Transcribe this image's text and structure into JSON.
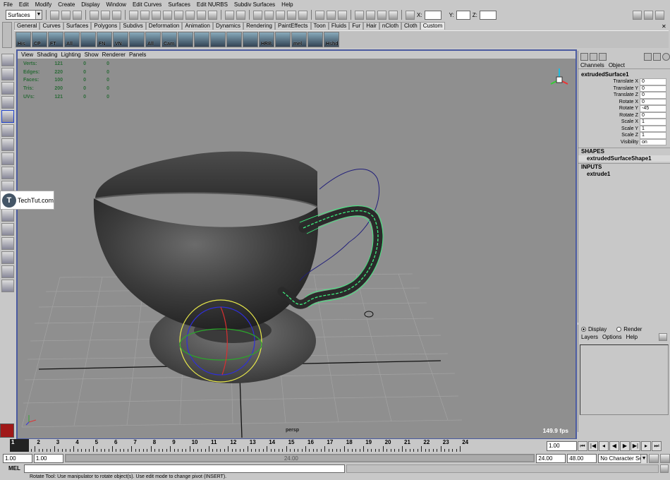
{
  "menus": [
    "File",
    "Edit",
    "Modify",
    "Create",
    "Display",
    "Window",
    "Edit Curves",
    "Surfaces",
    "Edit NURBS",
    "Subdiv Surfaces",
    "Help"
  ],
  "status": {
    "menuset": "Surfaces",
    "x_label": "X:",
    "y_label": "Y:",
    "z_label": "Z:"
  },
  "shelf_tabs": [
    "General",
    "Curves",
    "Surfaces",
    "Polygons",
    "Subdivs",
    "Deformation",
    "Animation",
    "Dynamics",
    "Rendering",
    "PaintEffects",
    "Toon",
    "Fluids",
    "Fur",
    "Hair",
    "nCloth",
    "Cloth",
    "Custom"
  ],
  "active_shelf_tab": "Custom",
  "shelf_buttons": [
    "His",
    "CP",
    "FT",
    "All",
    "",
    "FN",
    "VN",
    "",
    "All",
    "Cam",
    "",
    "",
    "",
    "",
    "",
    "HRB",
    "",
    "mel",
    "",
    "Hshd"
  ],
  "panel_menu": [
    "View",
    "Shading",
    "Lighting",
    "Show",
    "Renderer",
    "Panels"
  ],
  "hud": [
    {
      "label": "Verts:",
      "a": "121",
      "b": "0",
      "c": "0"
    },
    {
      "label": "Edges:",
      "a": "220",
      "b": "0",
      "c": "0"
    },
    {
      "label": "Faces:",
      "a": "100",
      "b": "0",
      "c": "0"
    },
    {
      "label": "Tris:",
      "a": "200",
      "b": "0",
      "c": "0"
    },
    {
      "label": "UVs:",
      "a": "121",
      "b": "0",
      "c": "0"
    }
  ],
  "viewport": {
    "camera": "persp",
    "fps": "149.9 fps"
  },
  "watermark": {
    "logo": "T",
    "text": "TechTut.com"
  },
  "channel_box": {
    "tabs": [
      "Channels",
      "Object"
    ],
    "object": "extrudedSurface1",
    "attributes": [
      {
        "name": "Translate X",
        "value": "0"
      },
      {
        "name": "Translate Y",
        "value": "0"
      },
      {
        "name": "Translate Z",
        "value": "0"
      },
      {
        "name": "Rotate X",
        "value": "0"
      },
      {
        "name": "Rotate Y",
        "value": "-45"
      },
      {
        "name": "Rotate Z",
        "value": "0"
      },
      {
        "name": "Scale X",
        "value": "1"
      },
      {
        "name": "Scale Y",
        "value": "1"
      },
      {
        "name": "Scale Z",
        "value": "1"
      },
      {
        "name": "Visibility",
        "value": "on"
      }
    ],
    "shapes_header": "SHAPES",
    "shape": "extrudedSurfaceShape1",
    "inputs_header": "INPUTS",
    "input": "extrude1"
  },
  "layer_editor": {
    "display": "Display",
    "render": "Render",
    "menu": [
      "Layers",
      "Options",
      "Help"
    ]
  },
  "timeline": {
    "ticks": [
      "1",
      "2",
      "3",
      "4",
      "5",
      "6",
      "7",
      "8",
      "9",
      "10",
      "11",
      "12",
      "13",
      "14",
      "15",
      "16",
      "17",
      "18",
      "19",
      "20",
      "21",
      "22",
      "23",
      "24"
    ],
    "current": "1"
  },
  "playback": {
    "current_field": "1.00"
  },
  "range": {
    "start": "1.00",
    "start2": "1.00",
    "end_label": "24.00",
    "end": "24.00",
    "end2": "48.00",
    "char_set": "No Character Set"
  },
  "command": {
    "label": "MEL"
  },
  "help_line": "Rotate Tool: Use manipulator to rotate object(s). Use edit mode to change pivot (INSERT)."
}
